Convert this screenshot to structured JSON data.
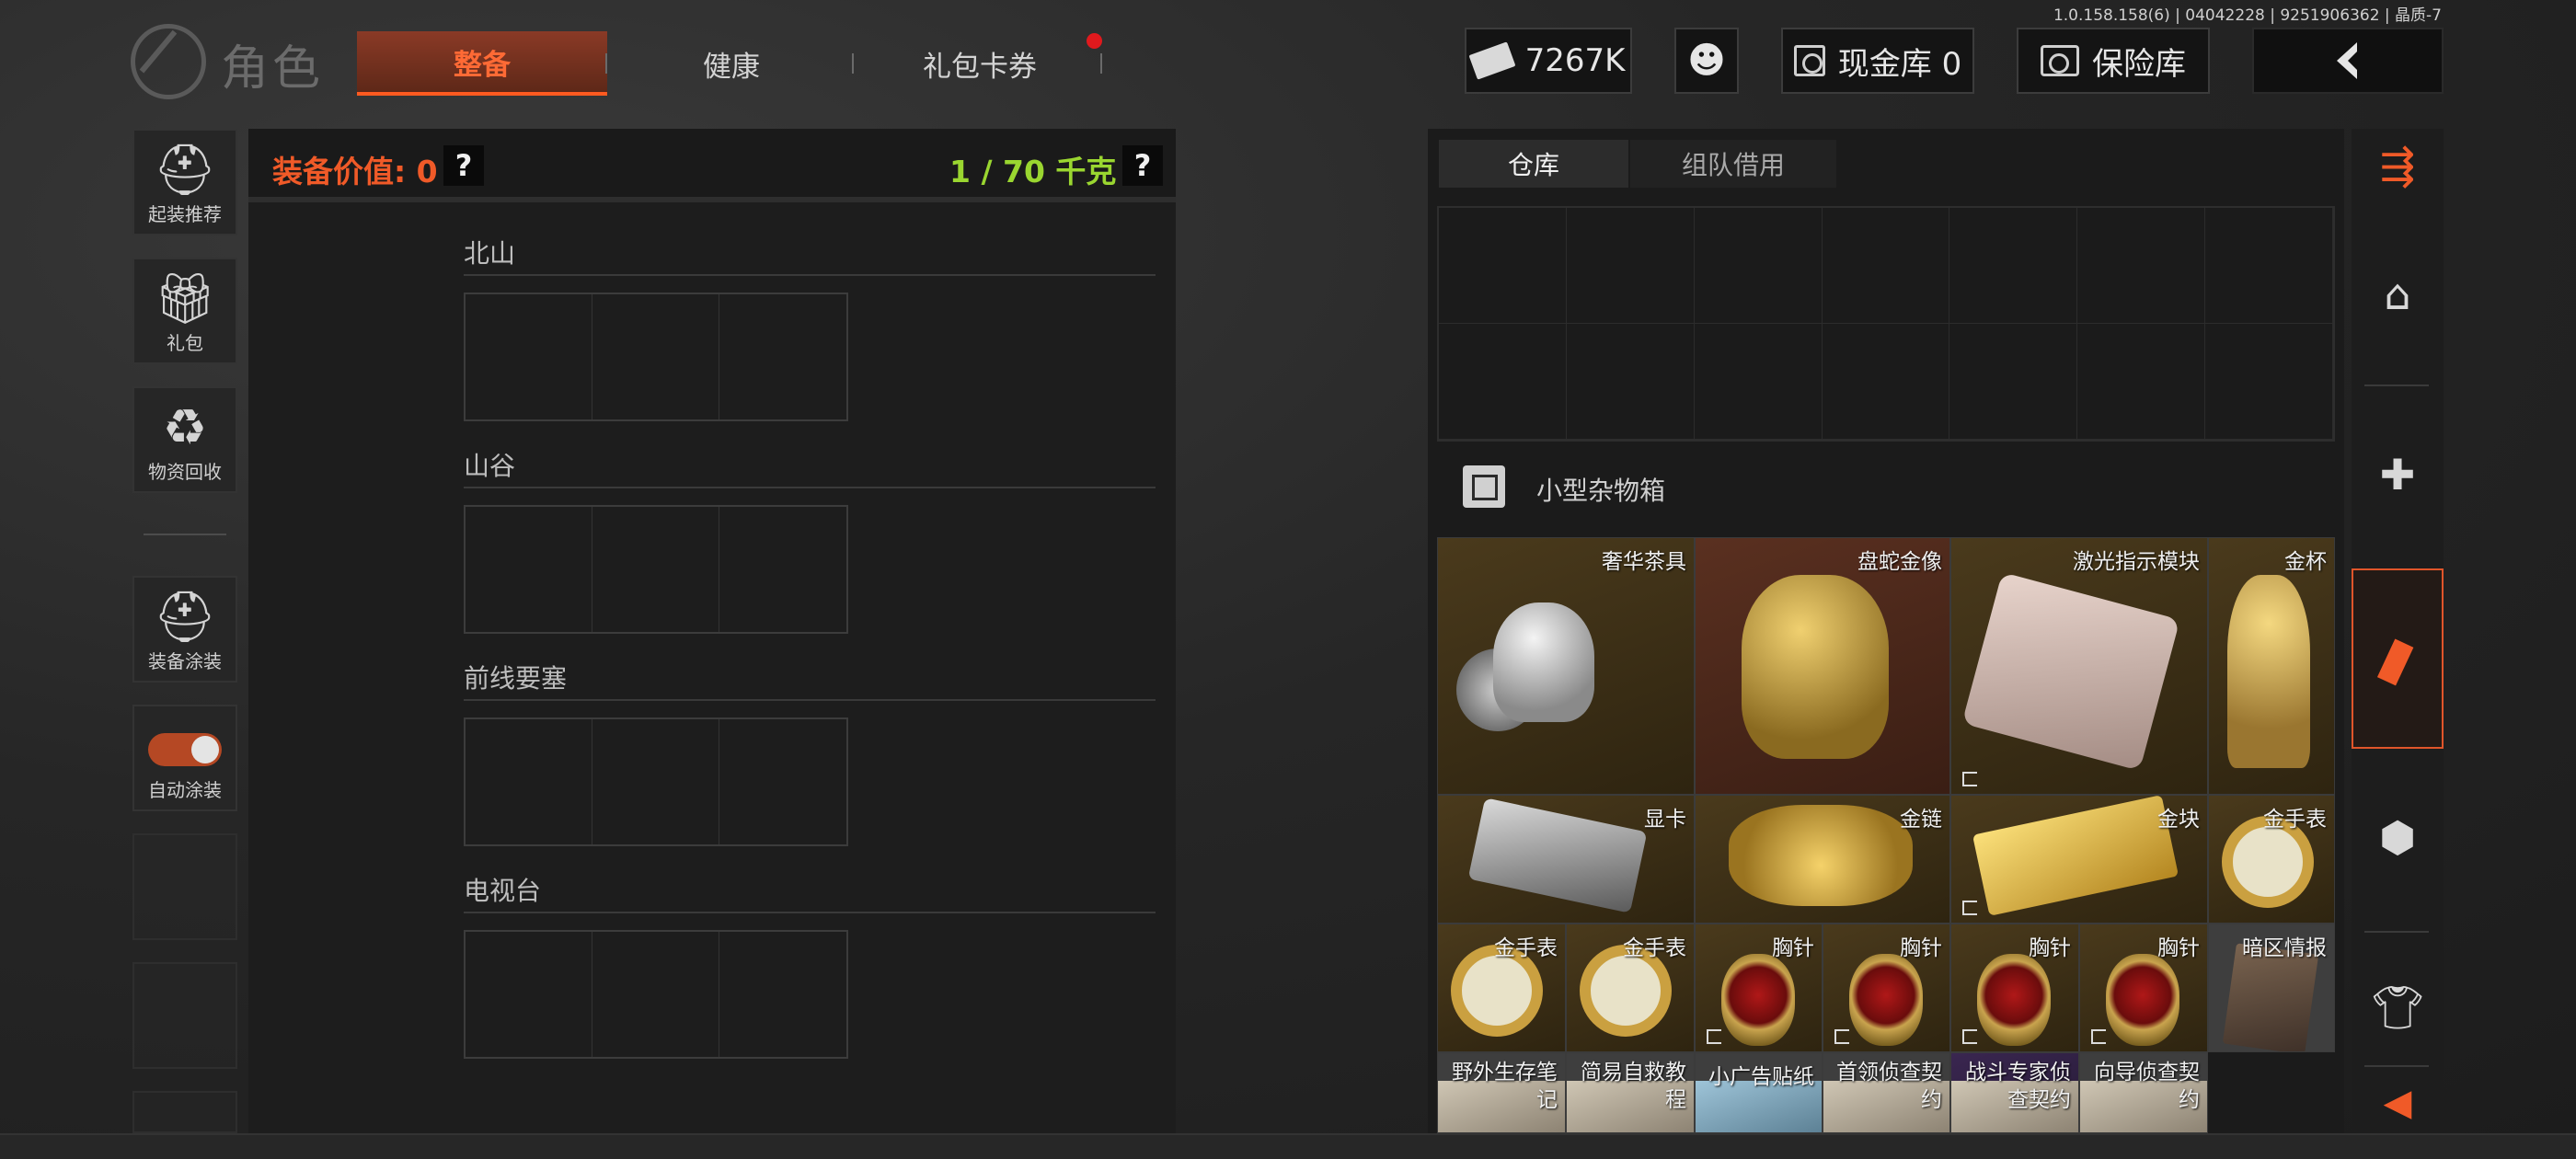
{
  "version": "1.0.158.158(6) | 04042228 | 9251906362 | 晶质-7",
  "header": {
    "title": "角色",
    "tabs": [
      {
        "label": "整备",
        "active": true
      },
      {
        "label": "健康",
        "active": false
      },
      {
        "label": "礼包卡券",
        "active": false,
        "badge": true
      }
    ],
    "money": "7267K",
    "cash_vault": "现金库 0",
    "safe_vault": "保险库",
    "back_icon": "chevron-left-icon"
  },
  "sidebar": {
    "items": [
      {
        "label": "起装推荐",
        "icon": "helmet-icon"
      },
      {
        "label": "礼包",
        "icon": "gift-icon"
      },
      {
        "label": "物资回收",
        "icon": "recycle-icon"
      },
      {
        "label": "装备涂装",
        "icon": "helmet-paint-icon"
      },
      {
        "label": "自动涂装",
        "icon": "toggle-icon"
      }
    ]
  },
  "equip_panel": {
    "value_label": "装备价值: 0",
    "weight_label": "1 / 70 千克",
    "help": "?",
    "maps": [
      "北山",
      "山谷",
      "前线要塞",
      "电视台"
    ]
  },
  "storage": {
    "tabs": [
      {
        "label": "仓库",
        "active": true
      },
      {
        "label": "组队借用",
        "active": false
      }
    ],
    "container_label": "小型杂物箱",
    "items": [
      {
        "name": "奢华茶具"
      },
      {
        "name": "盘蛇金像"
      },
      {
        "name": "激光指示模块"
      },
      {
        "name": "金杯"
      },
      {
        "name": "显卡"
      },
      {
        "name": "金链"
      },
      {
        "name": "金块"
      },
      {
        "name": "金手表"
      },
      {
        "name": "金手表"
      },
      {
        "name": "金手表"
      },
      {
        "name": "胸针"
      },
      {
        "name": "胸针"
      },
      {
        "name": "胸针"
      },
      {
        "name": "胸针"
      },
      {
        "name": "暗区情报"
      },
      {
        "name": "野外生存笔记"
      },
      {
        "name": "简易自救教程"
      },
      {
        "name": "小广告贴纸"
      },
      {
        "name": "首领侦查契约"
      },
      {
        "name": "战斗专家侦查契约"
      },
      {
        "name": "向导侦查契约"
      }
    ]
  },
  "colors": {
    "accent": "#f05a28",
    "weight_green": "#9ad630",
    "badge_red": "#e0191d"
  }
}
